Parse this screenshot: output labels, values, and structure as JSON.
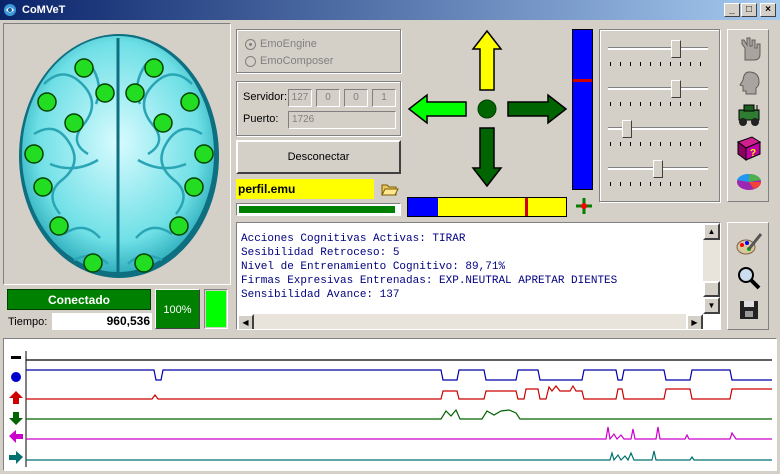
{
  "window": {
    "title": "CoMVeT",
    "minimize": "_",
    "maximize": "□",
    "close": "×"
  },
  "engine": {
    "options": [
      "EmoEngine",
      "EmoComposer"
    ]
  },
  "server": {
    "label": "Servidor:",
    "ip": [
      "127",
      "0",
      "0",
      "1"
    ],
    "port_label": "Puerto:",
    "port": "1726"
  },
  "disconnect_label": "Desconectar",
  "profile": {
    "name": "perfil.emu"
  },
  "status": {
    "connected": "Conectado",
    "percent": "100%",
    "time_label": "Tiempo:",
    "time_value": "960,536"
  },
  "log": {
    "lines": [
      "Acciones Cognitivas Activas: TIRAR",
      "Sesibilidad Retroceso: 5",
      "Nivel de Entrenamiento Cognitivo: 89,71%",
      "Firmas Expresivas Entrenadas: EXP.NEUTRAL APRETAR DIENTES",
      "Sensibilidad Avance: 137"
    ]
  },
  "colors": {
    "up": "#ffff00",
    "left": "#00ff00",
    "right": "#006400",
    "down": "#006400",
    "blue": "#0000ff",
    "red": "#ff0000",
    "yellow": "#ffff00",
    "green": "#008000"
  },
  "sliders": [
    0.7,
    0.7,
    0.15,
    0.5
  ],
  "progress": {
    "profile_bar": 0.98,
    "horizontal_level": 0.74,
    "vertical_level": 0.31
  },
  "icons": [
    "hand-icon",
    "head-icon",
    "robot-car-icon",
    "help-book-icon",
    "color-chart-icon",
    "palette-brush-icon",
    "magnifier-icon",
    "save-icon"
  ]
}
